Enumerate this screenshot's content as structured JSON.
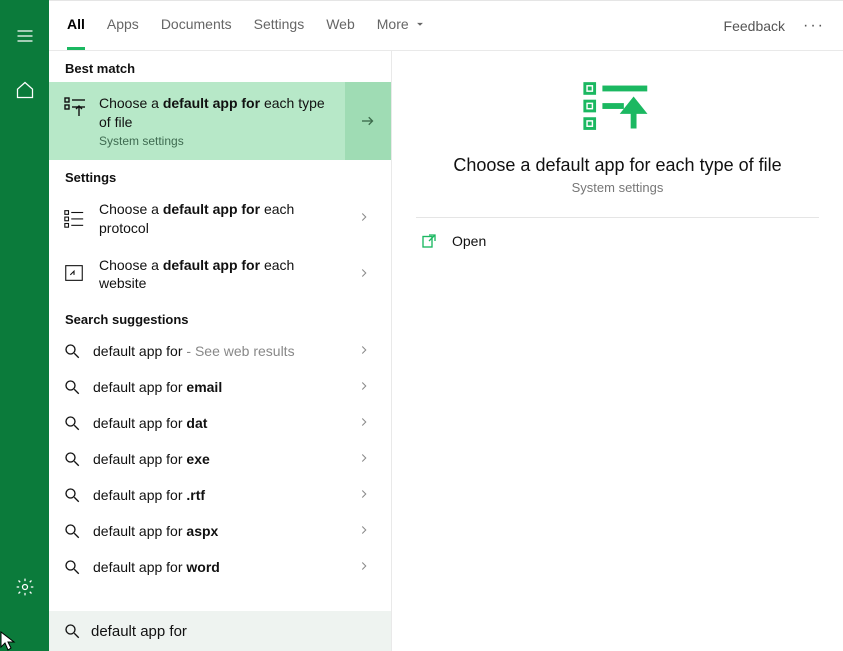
{
  "tabs": {
    "all": "All",
    "apps": "Apps",
    "documents": "Documents",
    "settings": "Settings",
    "web": "Web",
    "more": "More"
  },
  "topbar": {
    "feedback": "Feedback"
  },
  "sections": {
    "best_match": "Best match",
    "settings": "Settings",
    "search_suggestions": "Search suggestions"
  },
  "best": {
    "pre": "Choose a ",
    "bold": "default app for",
    "post": " each type of file",
    "sub": "System settings"
  },
  "settings_results": [
    {
      "pre": "Choose a ",
      "bold": "default app for",
      "post": " each protocol"
    },
    {
      "pre": "Choose a ",
      "bold": "default app for",
      "post": " each website"
    }
  ],
  "suggestions": [
    {
      "pre": "default app for",
      "bold": "",
      "post": "",
      "tail": " - See web results"
    },
    {
      "pre": "default app for ",
      "bold": "email",
      "post": "",
      "tail": ""
    },
    {
      "pre": "default app for ",
      "bold": "dat",
      "post": "",
      "tail": ""
    },
    {
      "pre": "default app for ",
      "bold": "exe",
      "post": "",
      "tail": ""
    },
    {
      "pre": "default app for ",
      "bold": ".rtf",
      "post": "",
      "tail": ""
    },
    {
      "pre": "default app for ",
      "bold": "aspx",
      "post": "",
      "tail": ""
    },
    {
      "pre": "default app for ",
      "bold": "word",
      "post": "",
      "tail": ""
    }
  ],
  "search": {
    "value": "default app for"
  },
  "preview": {
    "title": "Choose a default app for each type of file",
    "sub": "System settings",
    "open": "Open"
  }
}
